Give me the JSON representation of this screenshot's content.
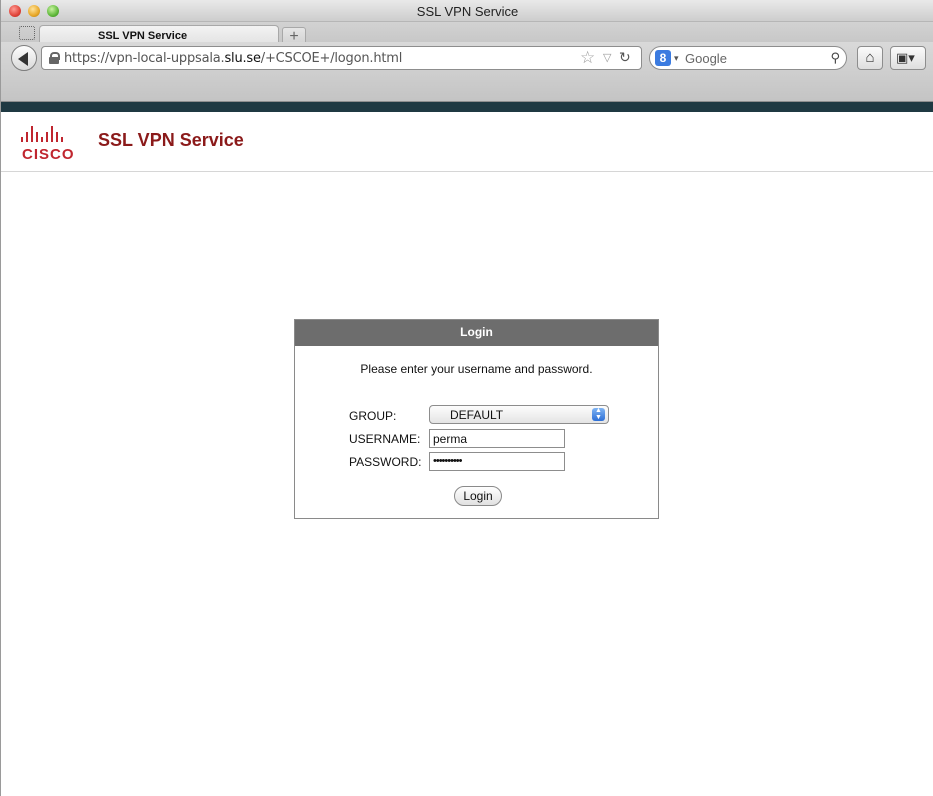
{
  "window": {
    "title": "SSL VPN Service"
  },
  "tabs": [
    {
      "label": "SSL VPN Service"
    }
  ],
  "newtab_glyph": "+",
  "navbar": {
    "url_prefix": "https://vpn-local-uppsala.",
    "url_host": "slu.se",
    "url_suffix": "/+CSCOE+/logon.html",
    "search_engine_label": "Google",
    "search_engine_badge": "8"
  },
  "icons": {
    "back": "back-arrow-icon",
    "lock": "lock-icon",
    "star": "bookmark-star-icon",
    "reload": "reload-icon",
    "search": "magnifier-icon",
    "home": "home-icon",
    "bookmarks": "bookmarks-menu-icon"
  },
  "brand": {
    "logo_text": "CISCO",
    "title": "SSL VPN Service",
    "color": "#8b1a1a",
    "logo_color": "#c0262f"
  },
  "login": {
    "header": "Login",
    "prompt": "Please enter your username and password.",
    "group_label": "GROUP:",
    "group_value": "DEFAULT",
    "username_label": "USERNAME:",
    "username_value": "perma",
    "password_label": "PASSWORD:",
    "password_mask": "••••••••••",
    "button_label": "Login"
  }
}
